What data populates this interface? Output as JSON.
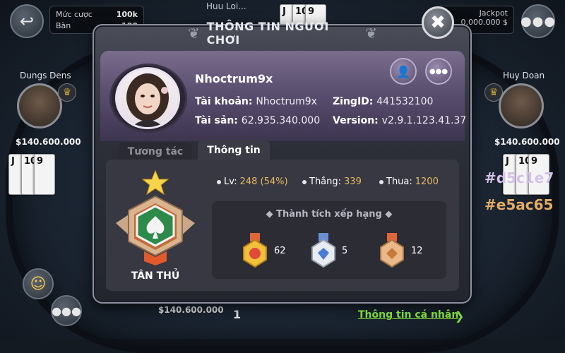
{
  "table": {
    "bet_label": "Mức cược",
    "bet_value": "100k",
    "table_label": "Bàn",
    "table_value": "100",
    "jackpot_label": "Jackpot",
    "jackpot_value": "0.000.000 $",
    "top_player_name": "Huu Loi...",
    "left_player": {
      "name": "Dungs Dens",
      "money": "$140.600.000"
    },
    "right_player": {
      "name": "Huy Doan",
      "money": "$140.600.000"
    },
    "bottom_money": "$140.600.000",
    "bottom_count": "1",
    "left_cards": [
      "J",
      "10",
      "9"
    ],
    "right_cards": [
      "J",
      "10",
      "9"
    ],
    "top_cards": [
      "J",
      "10",
      "9"
    ],
    "color_tags": [
      "#d5c1e7",
      "#e5ac65"
    ]
  },
  "dialog": {
    "title": "THÔNG TIN NGƯỜI CHƠI",
    "close_label": "✖",
    "player": {
      "name": "Nhoctrum9x",
      "account_label": "Tài khoản:",
      "account_value": "Nhoctrum9x",
      "zingid_label": "ZingID:",
      "zingid_value": "441532100",
      "assets_label": "Tài sản:",
      "assets_value": "62.935.340.000",
      "version_label": "Version:",
      "version_value": "v2.9.1.123.41.37"
    },
    "tabs": [
      {
        "label": "Tương tác",
        "active": false
      },
      {
        "label": "Thông tin",
        "active": true
      }
    ],
    "rank_label": "TÂN THỦ",
    "stats": {
      "level_label": "Lv:",
      "level_value": "248 (54%)",
      "wins_label": "Thắng:",
      "wins_value": "339",
      "losses_label": "Thua:",
      "losses_value": "1200"
    },
    "achievements": {
      "title": "◆ Thành tích xếp hạng ◆",
      "medals": [
        {
          "icon": "gold-medal-icon",
          "count": "62"
        },
        {
          "icon": "silver-medal-icon",
          "count": "5"
        },
        {
          "icon": "bronze-medal-icon",
          "count": "12"
        }
      ]
    },
    "personal_link": "Thông tin cá nhân"
  },
  "colors": {
    "accent_orange": "#e8b765",
    "link_green": "#7dd83b",
    "panel_purple": "#5b4f70",
    "tag_lilac": "#d5c1e7",
    "tag_orange": "#e5ac65"
  }
}
